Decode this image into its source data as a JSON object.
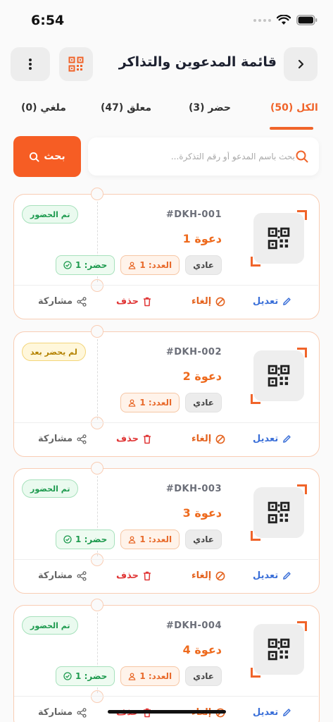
{
  "status": {
    "time": "6:54"
  },
  "header": {
    "title": "قائمة المدعوين والتذاكر",
    "back_icon": "chevron-right-icon",
    "more_icon": "more-vertical-icon",
    "qr_icon": "qr-code-icon"
  },
  "tabs": [
    {
      "label": "الكل (50)",
      "active": true
    },
    {
      "label": "حضر (3)",
      "active": false
    },
    {
      "label": "معلق (47)",
      "active": false
    },
    {
      "label": "ملغي (0)",
      "active": false
    }
  ],
  "search": {
    "placeholder": "بحث باسم المدعو أو رقم التذكرة...",
    "value": "",
    "button_label": "بحث"
  },
  "colors": {
    "accent": "#f0642a",
    "attended": "#1d9a4e",
    "pending": "#b48200",
    "edit": "#3a6fd8",
    "delete": "#e03636"
  },
  "cards": [
    {
      "code": "#DKH-001",
      "name": "دعوة 1",
      "type": "عادي",
      "count": "العدد: 1",
      "attended": "حضر: 1",
      "status": "تم الحضور",
      "actions": {
        "edit": "تعديل",
        "cancel": "إلغاء",
        "delete": "حذف",
        "share": "مشاركة"
      }
    },
    {
      "code": "#DKH-002",
      "name": "دعوة 2",
      "type": "عادي",
      "count": "العدد: 1",
      "attended": "",
      "status": "لم يحضر بعد",
      "actions": {
        "edit": "تعديل",
        "cancel": "إلغاء",
        "delete": "حذف",
        "share": "مشاركة"
      }
    },
    {
      "code": "#DKH-003",
      "name": "دعوة 3",
      "type": "عادي",
      "count": "العدد: 1",
      "attended": "حضر: 1",
      "status": "تم الحضور",
      "actions": {
        "edit": "تعديل",
        "cancel": "إلغاء",
        "delete": "حذف",
        "share": "مشاركة"
      }
    },
    {
      "code": "#DKH-004",
      "name": "دعوة 4",
      "type": "عادي",
      "count": "العدد: 1",
      "attended": "حضر: 1",
      "status": "تم الحضور",
      "actions": {
        "edit": "تعديل",
        "cancel": "إلغاء",
        "delete": "حذف",
        "share": "مشاركة"
      }
    }
  ]
}
